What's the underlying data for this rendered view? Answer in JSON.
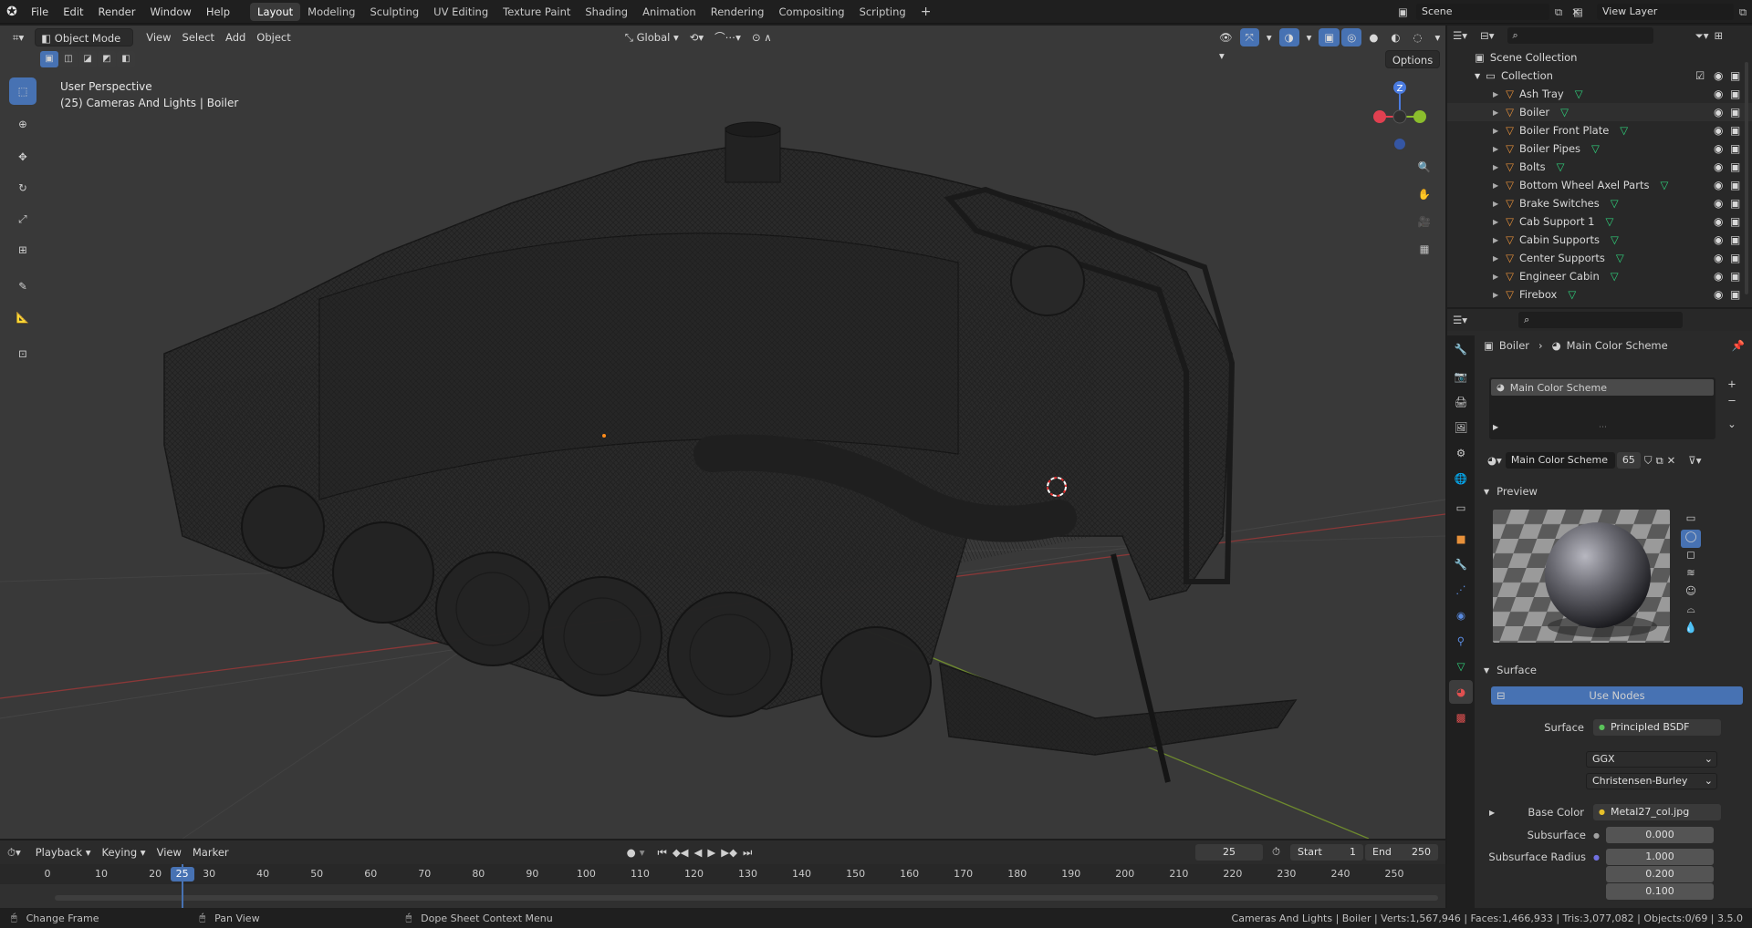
{
  "topbar": {
    "menus": [
      "File",
      "Edit",
      "Render",
      "Window",
      "Help"
    ],
    "workspaces": [
      "Layout",
      "Modeling",
      "Sculpting",
      "UV Editing",
      "Texture Paint",
      "Shading",
      "Animation",
      "Rendering",
      "Compositing",
      "Scripting"
    ],
    "active_workspace": "Layout",
    "scene": "Scene",
    "view_layer": "View Layer"
  },
  "viewport": {
    "mode": "Object Mode",
    "menus": [
      "View",
      "Select",
      "Add",
      "Object"
    ],
    "transform_orientation": "Global",
    "options_label": "Options",
    "overlay_title": "User Perspective",
    "overlay_subtitle": "(25) Cameras And Lights | Boiler",
    "gizmo_axes": {
      "z": "Z"
    }
  },
  "outliner": {
    "root": "Scene Collection",
    "collection": "Collection",
    "items": [
      "Ash Tray",
      "Boiler",
      "Boiler Front Plate",
      "Boiler Pipes",
      "Bolts",
      "Bottom Wheel Axel Parts",
      "Brake Switches",
      "Cab Support 1",
      "Cabin Supports",
      "Center Supports",
      "Engineer Cabin",
      "Firebox"
    ],
    "selected": "Boiler"
  },
  "properties": {
    "breadcrumb_object": "Boiler",
    "breadcrumb_material": "Main Color Scheme",
    "slot_name": "Main Color Scheme",
    "material_name": "Main Color Scheme",
    "user_count": "65",
    "preview_label": "Preview",
    "surface_label": "Surface",
    "use_nodes_label": "Use Nodes",
    "surface_field_label": "Surface",
    "surface_value": "Principled BSDF",
    "distribution": "GGX",
    "subsurface_method": "Christensen-Burley",
    "base_color_label": "Base Color",
    "base_color_value": "Metal27_col.jpg",
    "subsurface_label": "Subsurface",
    "subsurface_value": "0.000",
    "subsurface_radius_label": "Subsurface Radius",
    "subsurface_radius": [
      "1.000",
      "0.200",
      "0.100"
    ]
  },
  "timeline": {
    "menus": [
      "Playback",
      "Keying",
      "View",
      "Marker"
    ],
    "current_frame": "25",
    "start_label": "Start",
    "start_value": "1",
    "end_label": "End",
    "end_value": "250",
    "ruler": [
      "0",
      "10",
      "20",
      "30",
      "40",
      "50",
      "60",
      "70",
      "80",
      "90",
      "100",
      "110",
      "120",
      "130",
      "140",
      "150",
      "160",
      "170",
      "180",
      "190",
      "200",
      "210",
      "220",
      "230",
      "240",
      "250"
    ]
  },
  "statusbar": {
    "hint1": "Change Frame",
    "hint2": "Pan View",
    "hint3": "Dope Sheet Context Menu",
    "stats": "Cameras And Lights | Boiler | Verts:1,567,946 | Faces:1,466,933 | Tris:3,077,082 | Objects:0/69 | 3.5.0"
  },
  "colors": {
    "accent": "#4772b3",
    "active_tool": "#4772b3",
    "mesh_icon": "#e8913a",
    "mesh_data_icon": "#2fd07b"
  }
}
